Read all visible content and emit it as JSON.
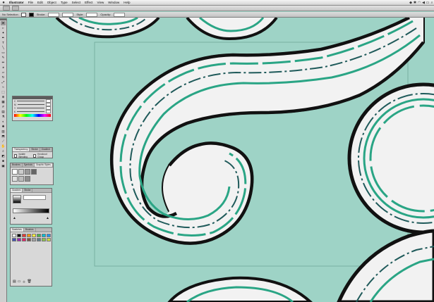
{
  "app": {
    "name": "Illustrator",
    "menus": [
      "File",
      "Edit",
      "Object",
      "Type",
      "Select",
      "Effect",
      "View",
      "Window",
      "Help"
    ]
  },
  "menubar_status": {
    "icons": [
      "dropbox-icon",
      "bluetooth-icon",
      "wifi-icon",
      "volume-icon",
      "battery-icon"
    ]
  },
  "control_bar": {
    "selection_label": "No Selection",
    "stroke_label": "Stroke:",
    "style_label": "Style:",
    "opacity_label": "Opacity:"
  },
  "panels": {
    "color": {
      "label_c": "C",
      "label_m": "M",
      "label_y": "Y",
      "label_k": "K"
    },
    "transparency": {
      "tabs": [
        "Transparency",
        "Stroke",
        "Gradient"
      ],
      "isolate": "Isolate Blending",
      "knockout": "Knockout Group"
    },
    "graphic_styles": {
      "tabs": [
        "Brushes",
        "Symbols",
        "Graphic Styles"
      ]
    },
    "gradient": {
      "tabs": [
        "Gradient",
        "Stroke"
      ]
    },
    "swatches": {
      "tabs": [
        "Swatches",
        "Brushes"
      ]
    }
  },
  "colors": {
    "canvas_bg": "#9ed3c6",
    "shape_fill": "#f2f2f2",
    "outline": "#111111",
    "stripe_teal": "#2aa585",
    "stripe_dark": "#1f5a5a"
  },
  "swatches": [
    "#ffffff",
    "#000000",
    "#e53935",
    "#ff9800",
    "#ffeb3b",
    "#4caf50",
    "#00bcd4",
    "#2196f3",
    "#3f51b5",
    "#9c27b0",
    "#e91e63",
    "#795548",
    "#9e9e9e",
    "#607d8b",
    "#8bc34a",
    "#cddc39"
  ]
}
